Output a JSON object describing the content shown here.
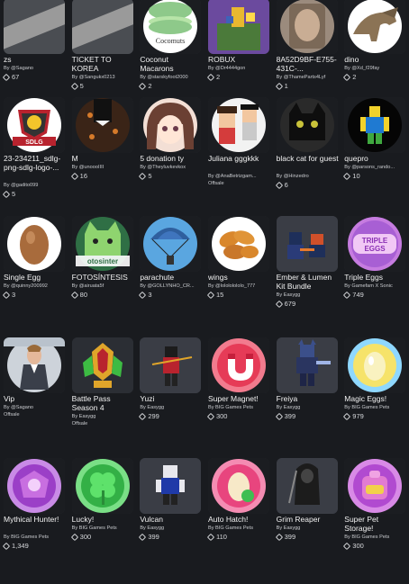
{
  "items": [
    {
      "title": "zs",
      "creator": "By @Sagano",
      "status": "",
      "price": "67",
      "thumb": "tape",
      "bg": "#4a4d52"
    },
    {
      "title": "TICKET TO KOREA",
      "creator": "By @Sangukx0213",
      "status": "",
      "price": "5",
      "thumb": "tape",
      "bg": "#4a4d52"
    },
    {
      "title": "Coconut Macarons",
      "creator": "By @starskyfoot2000",
      "status": "",
      "price": "2",
      "thumb": "macaron",
      "bg": "#ffffff"
    },
    {
      "title": "ROBUX",
      "creator": "By @Dr4444gon",
      "status": "",
      "price": "2",
      "thumb": "robux",
      "bg": "#6b4a9e"
    },
    {
      "title": "8A52D9BF-E755-431C-...",
      "creator": "By @ThameParts4Lyf",
      "status": "",
      "price": "1",
      "thumb": "hand",
      "bg": "#8a7a6c"
    },
    {
      "title": "dino",
      "creator": "By @Xd_f29fay",
      "status": "",
      "price": "2",
      "thumb": "dino",
      "bg": "#ffffff"
    },
    {
      "title": "23-234211_sdlg-png-sdlg-logo-...",
      "creator": "By @gadito099",
      "status": "",
      "price": "5",
      "thumb": "sdlg",
      "bg": "#ffffff"
    },
    {
      "title": "M",
      "creator": "By @unoooIIII",
      "status": "",
      "price": "16",
      "thumb": "leopard",
      "bg": "#2a1b14"
    },
    {
      "title": "5 donation ty",
      "creator": "By @Theyluvkevkox",
      "status": "",
      "price": "5",
      "thumb": "anime",
      "bg": "#f3dfd5"
    },
    {
      "title": "Juliana gggkkk",
      "creator": "By @AnaBetrizgam...",
      "status": "Offsale",
      "price": "",
      "thumb": "roblox-girls",
      "bg": "#f2f2f2"
    },
    {
      "title": "black cat for guest",
      "creator": "By @Hinzedro",
      "status": "",
      "price": "6",
      "thumb": "cat",
      "bg": "#2a2a2a"
    },
    {
      "title": "quepro",
      "creator": "By @parsons_rando...",
      "status": "",
      "price": "10",
      "thumb": "noob",
      "bg": "#050505"
    },
    {
      "title": "Single Egg",
      "creator": "By @quinny200992",
      "status": "",
      "price": "3",
      "thumb": "egg",
      "bg": "#ffffff"
    },
    {
      "title": "FOTOSÍNTESIS",
      "creator": "By @airuata5f",
      "status": "",
      "price": "80",
      "thumb": "greencat",
      "bg": "#2f6f45"
    },
    {
      "title": "parachute",
      "creator": "By @GOLLYNHO_CR...",
      "status": "",
      "price": "3",
      "thumb": "parachute",
      "bg": "#5aa6e0"
    },
    {
      "title": "wings",
      "creator": "By @lolololololo_777",
      "status": "",
      "price": "15",
      "thumb": "wings",
      "bg": "#ffffff"
    },
    {
      "title": "Ember & Lumen Kit Bundle",
      "creator": "By Easygg",
      "status": "",
      "price": "679",
      "thumb": "ember",
      "bg": "#3a3d45"
    },
    {
      "title": "Triple Eggs",
      "creator": "By Gamefam X Sonic",
      "status": "",
      "price": "749",
      "thumb": "triple-eggs",
      "bg": "#ffffff"
    },
    {
      "title": "Vip",
      "creator": "By @Sagano",
      "status": "Offsale",
      "price": "",
      "thumb": "rick",
      "bg": "#cdd3da"
    },
    {
      "title": "Battle Pass Season 4",
      "creator": "By Easygg",
      "status": "Offsale",
      "price": "",
      "thumb": "battlepass",
      "bg": "#2b2e34"
    },
    {
      "title": "Yuzi",
      "creator": "By Easygg",
      "status": "",
      "price": "299",
      "thumb": "yuzi",
      "bg": "#3a3d45"
    },
    {
      "title": "Super Magnet!",
      "creator": "By BIG Games Pets",
      "status": "",
      "price": "300",
      "thumb": "magnet",
      "bg": "#e63b57"
    },
    {
      "title": "Freiya",
      "creator": "By Easygg",
      "status": "",
      "price": "399",
      "thumb": "freiya",
      "bg": "#3a3d45"
    },
    {
      "title": "Magic Eggs!",
      "creator": "By BIG Games Pets",
      "status": "",
      "price": "979",
      "thumb": "magic-egg",
      "bg": "#9be2ff"
    },
    {
      "title": "Mythical Hunter!",
      "creator": "By BIG Games Pets",
      "status": "",
      "price": "1,349",
      "thumb": "mythical",
      "bg": "#b75ad9"
    },
    {
      "title": "Lucky!",
      "creator": "By BIG Games Pets",
      "status": "",
      "price": "300",
      "thumb": "lucky",
      "bg": "#3fbe52"
    },
    {
      "title": "Vulcan",
      "creator": "By Easygg",
      "status": "",
      "price": "399",
      "thumb": "vulcan",
      "bg": "#3a3d45"
    },
    {
      "title": "Auto Hatch!",
      "creator": "By BIG Games Pets",
      "status": "",
      "price": "110",
      "thumb": "autohatch",
      "bg": "#e8457e"
    },
    {
      "title": "Grim Reaper",
      "creator": "By Easygg",
      "status": "",
      "price": "399",
      "thumb": "reaper",
      "bg": "#3a3d45"
    },
    {
      "title": "Super Pet Storage!",
      "creator": "By BIG Games Pets",
      "status": "",
      "price": "300",
      "thumb": "storage",
      "bg": "#b14ad0"
    }
  ],
  "macaron_label": "Cocomuts",
  "triple_eggs_label": "TRIPLE EGGS",
  "sdlg_label": "SDLG",
  "fotosintesis_label": "otosinter"
}
